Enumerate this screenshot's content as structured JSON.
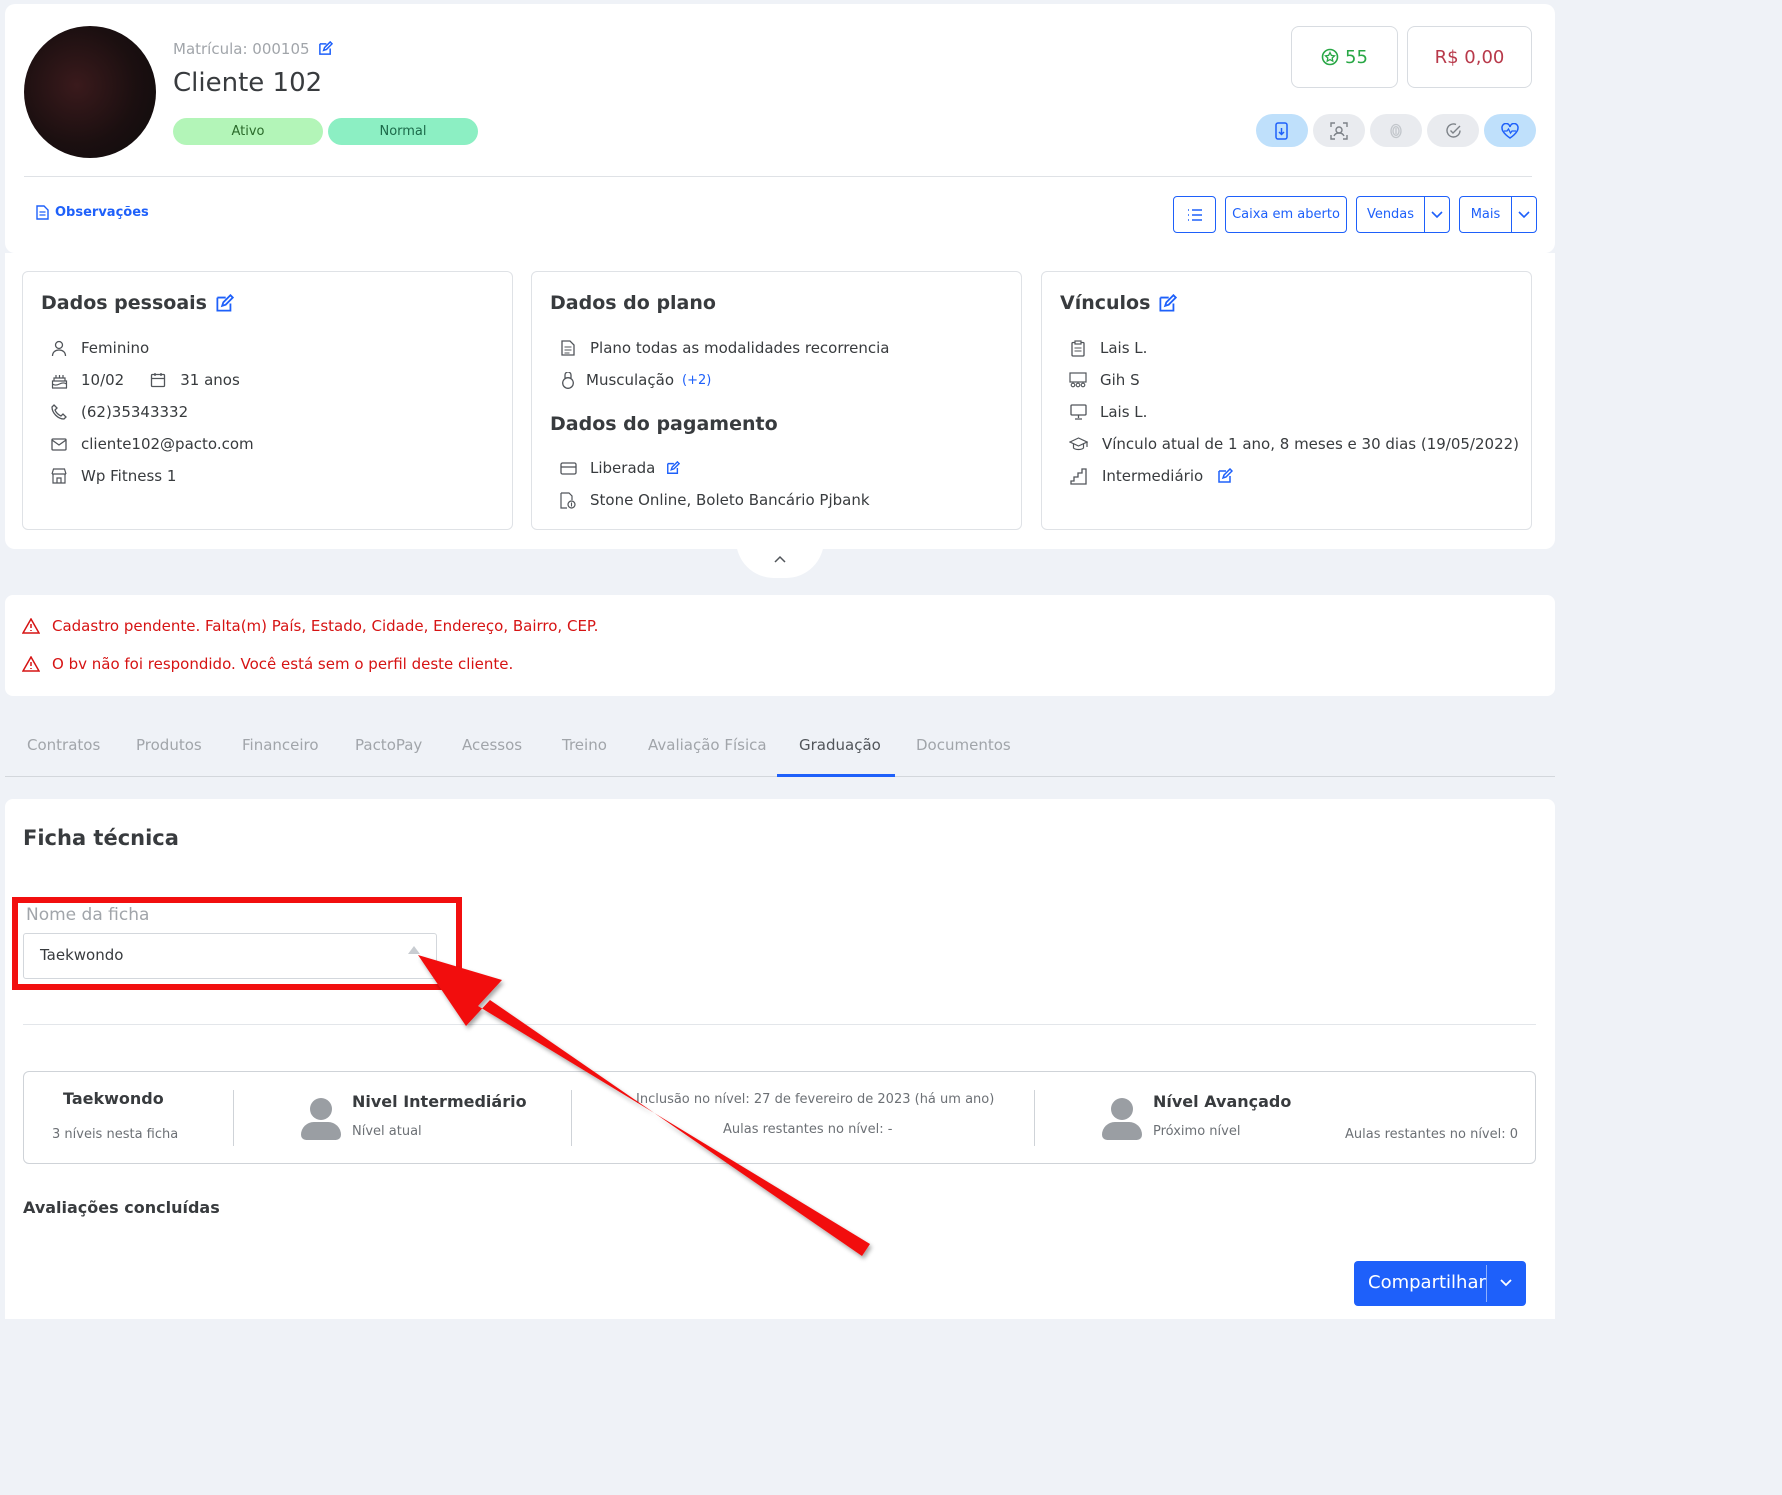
{
  "header": {
    "matricula": "Matrícula: 000105",
    "client_name": "Cliente 102",
    "status_badges": [
      "Ativo",
      "Normal"
    ],
    "points": "55",
    "balance": "R$ 0,00",
    "observacoes_label": "Observações",
    "action_buttons": {
      "caixa_label": "Caixa em aberto",
      "vendas_label": "Vendas",
      "mais_label": "Mais"
    }
  },
  "dados_pessoais": {
    "title": "Dados pessoais",
    "gender": "Feminino",
    "birthday": "10/02",
    "age": "31 anos",
    "phone": "(62)35343332",
    "email": "cliente102@pacto.com",
    "unit": "Wp Fitness 1"
  },
  "dados_plano": {
    "title": "Dados do plano",
    "plan": "Plano todas as modalidades recorrencia",
    "modality": "Musculação",
    "modality_extra": "(+2)",
    "payment_title": "Dados do pagamento",
    "payment_status": "Liberada",
    "payment_methods": "Stone Online, Boleto Bancário Pjbank"
  },
  "vinculos": {
    "title": "Vínculos",
    "consultant": "Lais L.",
    "trainer": "Gih S",
    "professor": "Lais L.",
    "vinculo_atual": "Vínculo atual de 1 ano, 8 meses e 30 dias (19/05/2022)",
    "level": "Intermediário"
  },
  "alerts": [
    "Cadastro pendente. Falta(m) País, Estado, Cidade, Endereço, Bairro, CEP.",
    "O bv não foi respondido. Você está sem o perfil deste cliente."
  ],
  "tabs": [
    "Contratos",
    "Produtos",
    "Financeiro",
    "PactoPay",
    "Acessos",
    "Treino",
    "Avaliação Física",
    "Graduação",
    "Documentos"
  ],
  "active_tab": "Graduação",
  "graduacao": {
    "title": "Ficha técnica",
    "field_label": "Nome da ficha",
    "selected_ficha": "Taekwondo",
    "summary": {
      "name": "Taekwondo",
      "levels_count": "3 níveis nesta ficha",
      "current_level": "Nivel Intermediário",
      "current_level_sub": "Nível atual",
      "inclusion": "Inclusão no nível: 27 de fevereiro de 2023 (há um ano)",
      "remaining_current": "Aulas restantes no nível: -",
      "next_level": "Nível Avançado",
      "next_level_sub": "Próximo nível",
      "remaining_next": "Aulas restantes no nível: 0"
    },
    "avaliacoes_title": "Avaliações concluídas",
    "share_label": "Compartilhar"
  },
  "colors": {
    "accent": "#1e60fa",
    "alert": "#d61313",
    "annotation": "#f20f0f",
    "points": "#28a745",
    "balance": "#b8394a"
  }
}
